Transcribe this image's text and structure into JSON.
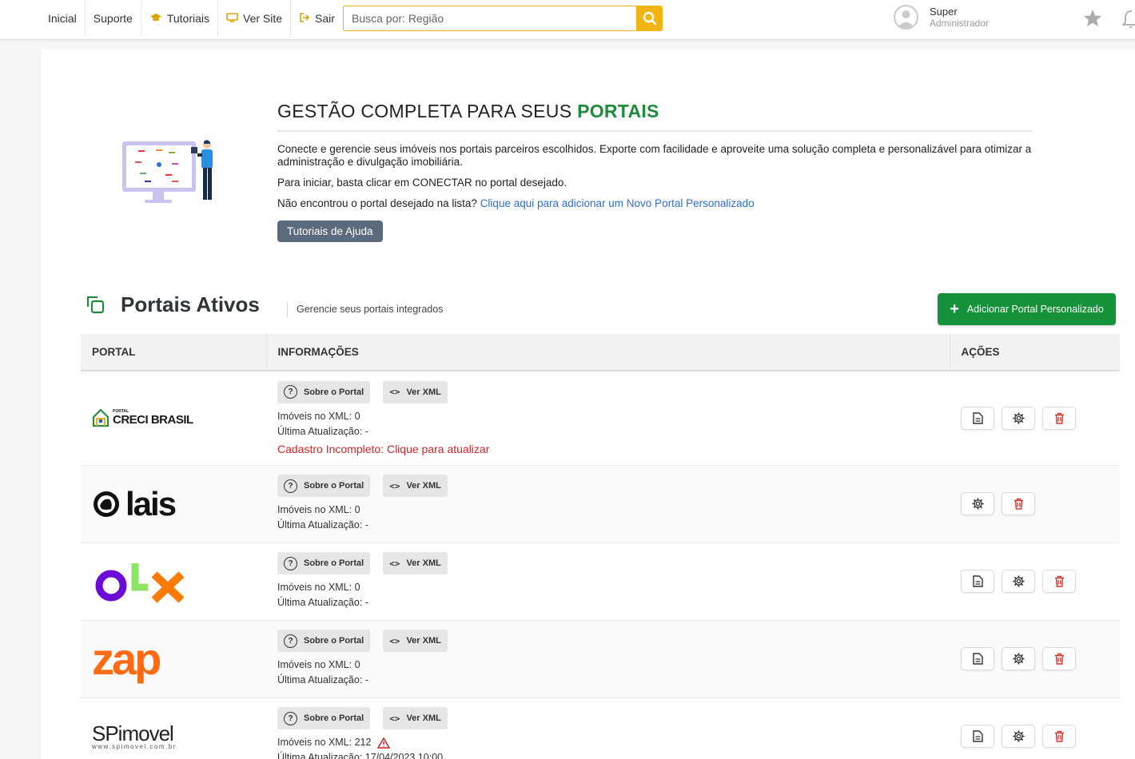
{
  "nav": {
    "items": [
      {
        "label": "Inicial",
        "icon": ""
      },
      {
        "label": "Suporte",
        "icon": ""
      },
      {
        "label": "Tutoriais",
        "icon": "graduation-cap-icon"
      },
      {
        "label": "Ver Site",
        "icon": "monitor-icon"
      },
      {
        "label": "Sair",
        "icon": "sign-out-icon"
      }
    ]
  },
  "search": {
    "placeholder": "Busca por: Região",
    "value": ""
  },
  "user": {
    "name": "Super",
    "role": "Administrador"
  },
  "hero": {
    "title_prefix": "GESTÃO COMPLETA PARA SEUS ",
    "title_accent": "PORTAIS",
    "paragraph1": "Conecte e gerencie seus imóveis nos portais parceiros escolhidos. Exporte com facilidade e aproveite uma solução completa e personalizável para otimizar a administração e divulgação imobiliária.",
    "paragraph2": "Para iniciar, basta clicar em CONECTAR no portal desejado.",
    "paragraph3_prefix": "Não encontrou o portal desejado na lista? ",
    "paragraph3_link": "Clique aqui para adicionar um Novo Portal Personalizado",
    "help_button": "Tutoriais de Ajuda"
  },
  "section": {
    "title": "Portais Ativos",
    "subtitle": "Gerencie seus portais integrados",
    "add_button": "Adicionar Portal Personalizado"
  },
  "table": {
    "headers": [
      "PORTAL",
      "INFORMAÇÕES",
      "AÇÕES"
    ],
    "about_label": "Sobre o Portal",
    "xml_label": "Ver XML",
    "rows": [
      {
        "portal": "CRECI BRASIL",
        "logo_small": "PORTAL",
        "xml_count": "Imóveis no XML: 0",
        "last_update": "Última Atualização: -",
        "warning": "Cadastro Incompleto: Clique para atualizar"
      },
      {
        "portal": "lais",
        "xml_count": "Imóveis no XML: 0",
        "last_update": "Última Atualização: -"
      },
      {
        "portal": "olx",
        "xml_count": "Imóveis no XML: 0",
        "last_update": "Última Atualização: -"
      },
      {
        "portal": "zap",
        "xml_count": "Imóveis no XML: 0",
        "last_update": "Última Atualização: -"
      },
      {
        "portal": "SPimovel",
        "logo_small": "www.spimovel.com.br",
        "xml_count": "Imóveis no XML: 212",
        "last_update": "Última Atualização: 17/04/2023 10:00"
      }
    ]
  },
  "colors": {
    "accent_green": "#1f8a3b",
    "button_green": "#15923a",
    "search_yellow": "#f2b411",
    "warning_red": "#d42525",
    "link_blue": "#2d6fd1",
    "delete_red": "#d9342b"
  }
}
